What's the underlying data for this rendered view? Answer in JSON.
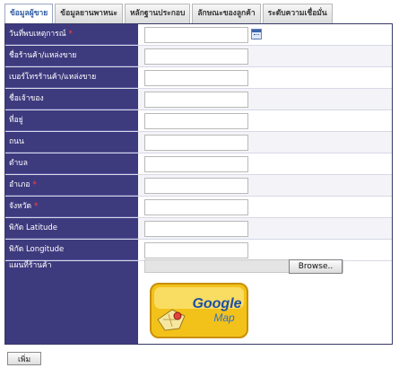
{
  "tabs": [
    {
      "label": "ข้อมูลผู้ขาย",
      "active": true
    },
    {
      "label": "ข้อมูลยานพาหนะ",
      "active": false
    },
    {
      "label": "หลักฐานประกอบ",
      "active": false
    },
    {
      "label": "ลักษณะของลูกค้า",
      "active": false
    },
    {
      "label": "ระดับความเชื่อมั่น",
      "active": false
    }
  ],
  "form": {
    "rows": [
      {
        "label": "วันที่พบเหตุการณ์",
        "required": true,
        "value": "",
        "has_calendar": true
      },
      {
        "label": "ชื่อร้านค้า/แหล่งขาย",
        "required": false,
        "value": ""
      },
      {
        "label": "เบอร์โทรร้านค้า/แหล่งขาย",
        "required": false,
        "value": ""
      },
      {
        "label": "ชื่อเจ้าของ",
        "required": false,
        "value": ""
      },
      {
        "label": "ที่อยู่",
        "required": false,
        "value": ""
      },
      {
        "label": "ถนน",
        "required": false,
        "value": ""
      },
      {
        "label": "ตำบล",
        "required": false,
        "value": ""
      },
      {
        "label": "อำเภอ",
        "required": true,
        "value": ""
      },
      {
        "label": "จังหวัด",
        "required": true,
        "value": ""
      },
      {
        "label": "พิกัด Latitude",
        "required": false,
        "value": ""
      },
      {
        "label": "พิกัด Longitude",
        "required": false,
        "value": ""
      }
    ],
    "required_mark": "*",
    "map_label": "แผนที่ร้านค้า",
    "browse_label": "Browse..",
    "google_map": {
      "line1": "Google",
      "line2": "Map"
    }
  },
  "add_button_label": "เพิ่ม",
  "colors": {
    "label_bg": "#3e3a7e",
    "required": "#ff4444",
    "tab_active_text": "#2d5aa0"
  }
}
